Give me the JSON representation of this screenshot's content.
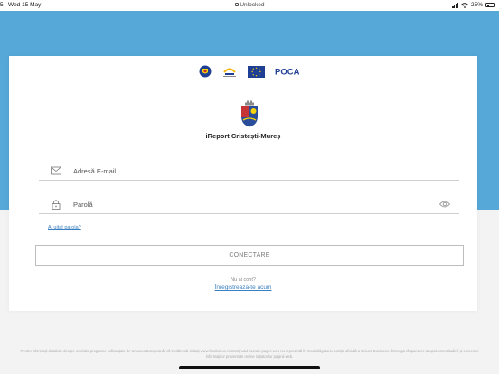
{
  "status_bar": {
    "time": "5",
    "date": "Wed 15 May",
    "center_label": "Unlocked",
    "battery": "25%"
  },
  "logos": [
    {
      "name": "government-crest-logo"
    },
    {
      "name": "ministry-logo"
    },
    {
      "name": "eu-flag-logo"
    },
    {
      "name": "poca-logo",
      "text": "POCA"
    }
  ],
  "app": {
    "title": "iReport Cristești-Mureș"
  },
  "login": {
    "email_placeholder": "Adresă E-mail",
    "password_placeholder": "Parolă",
    "forgot_password": "Ai uitat parola?",
    "connect_label": "CONECTARE",
    "no_account": "Nu ai cont?",
    "register_label": "Înregistrează-te acum"
  },
  "footer": {
    "text": "Pentru informații detaliate despre celelalte programe cofinanțate de Uniunea Europeană, vă invităm să vizitați www.fonduri-ue.ro Conținutul acestei pagini web nu reprezintă în mod obligatoriu poziția oficială a Uniunii Europene. Întreaga răspundere asupra corectitudinii și coerenței informațiilor prezentate revine inițiatorilor paginii web."
  },
  "colors": {
    "header_band": "#56a8d8",
    "link": "#3a7fbf",
    "eu_blue": "#1f3f95",
    "eu_star": "#f5d50a"
  }
}
